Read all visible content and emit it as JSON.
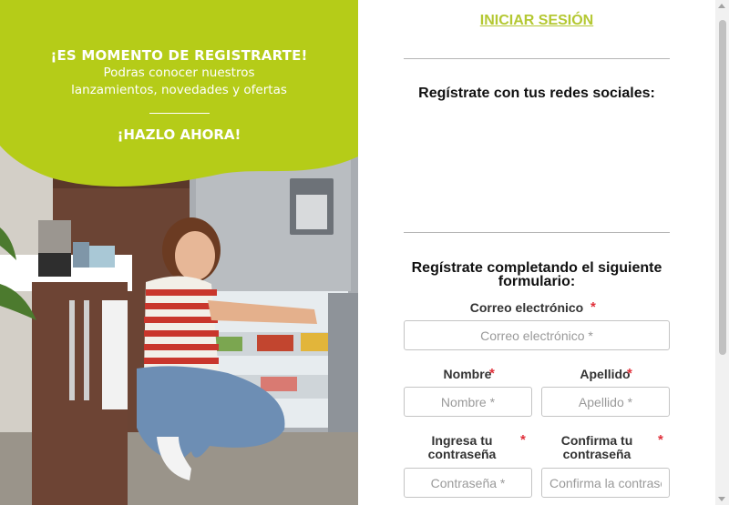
{
  "promo": {
    "headline": "¡ES MOMENTO DE REGISTRARTE!",
    "subtext_line1": "Podras conocer nuestros",
    "subtext_line2": "lanzamientos, novedades y ofertas",
    "cta": "¡HAZLO AHORA!",
    "accent_color": "#b5cc18"
  },
  "form": {
    "login_link": "INICIAR SESIÓN",
    "social_heading": "Regístrate con tus redes sociales:",
    "form_heading": "Regístrate completando el siguiente formulario:",
    "required_mark": "*",
    "email": {
      "label": "Correo electrónico",
      "placeholder": "Correo electrónico *"
    },
    "first_name": {
      "label": "Nombre",
      "placeholder": "Nombre *"
    },
    "last_name": {
      "label": "Apellido",
      "placeholder": "Apellido *"
    },
    "password": {
      "label": "Ingresa tu contraseña",
      "placeholder": "Contraseña *"
    },
    "confirm_password": {
      "label": "Confirma tu contraseña",
      "placeholder": "Confirma la contraseña *"
    }
  }
}
